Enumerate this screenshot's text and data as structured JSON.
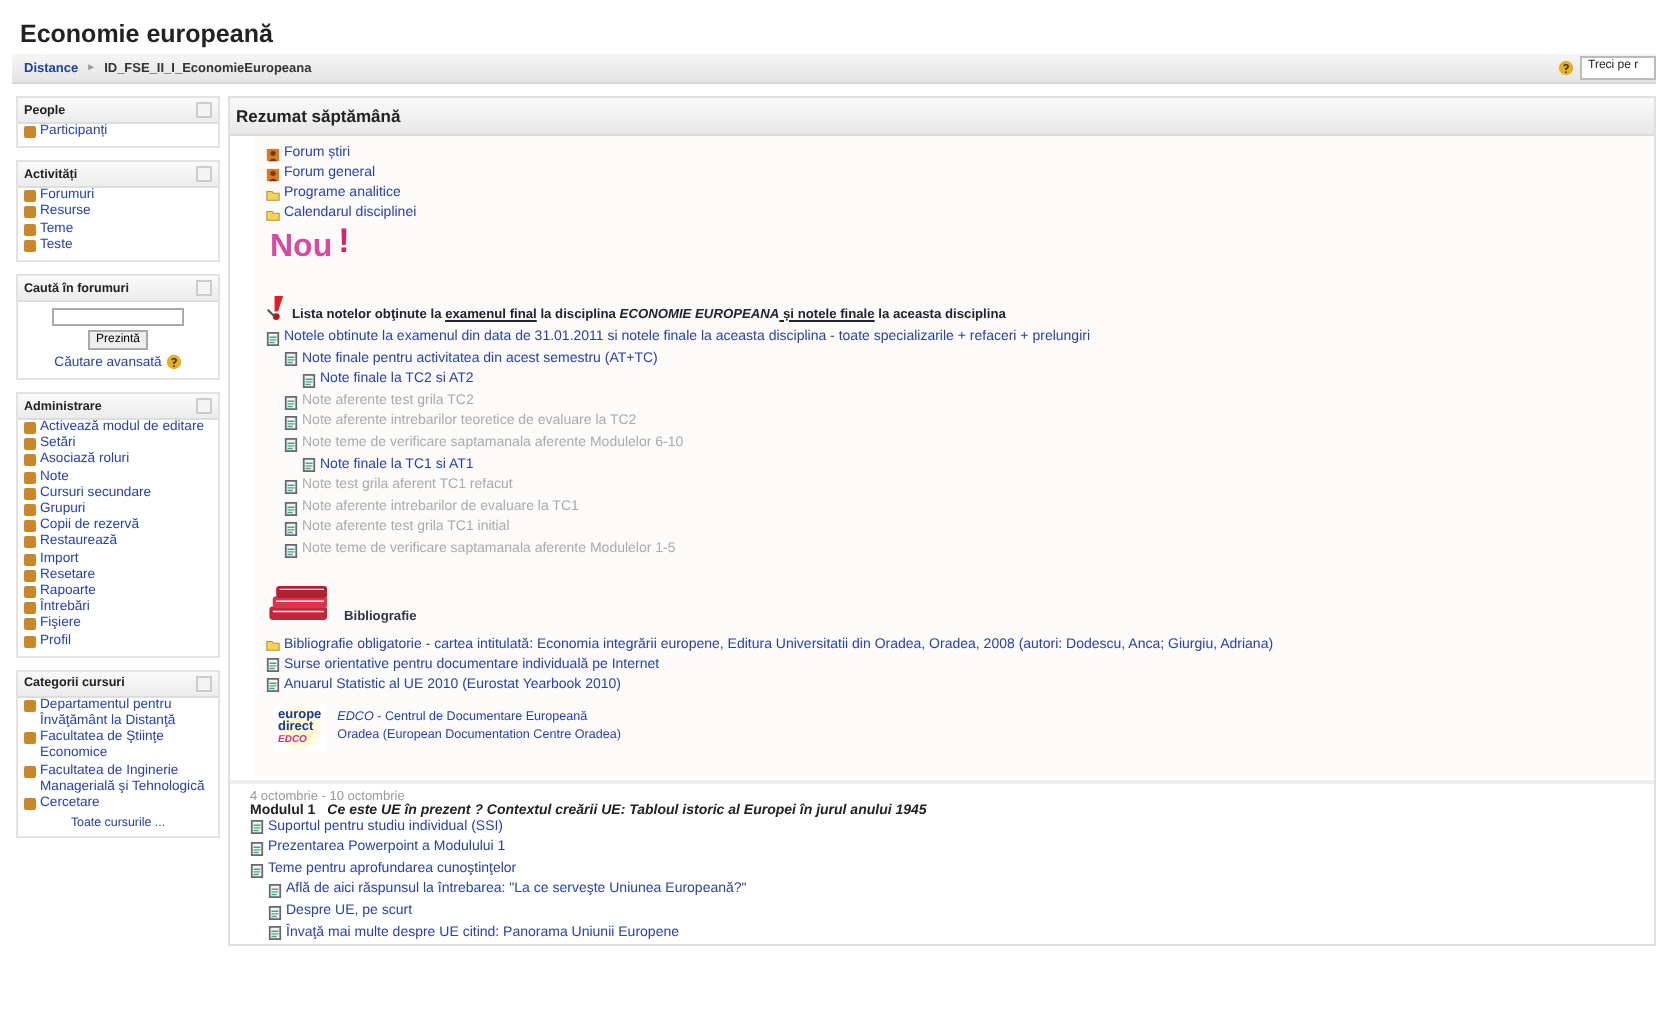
{
  "header": {
    "title": "Economie europeană",
    "breadcrumb": [
      {
        "label": "Distance",
        "link": true
      },
      {
        "label": "ID_FSE_II_I_EconomieEuropeana",
        "link": false
      }
    ],
    "separator": "►",
    "language_menu": {
      "value": "Treci pe r"
    }
  },
  "sidebar": {
    "blocks": [
      {
        "title": "People",
        "kind": "links",
        "items": [
          "Participanți"
        ]
      },
      {
        "title": "Activități",
        "kind": "links",
        "items": [
          "Forumuri",
          "Resurse",
          "Teme",
          "Teste"
        ]
      },
      {
        "title": "Caută în forumuri",
        "kind": "search",
        "button": "Prezintă",
        "advanced": "Căutare avansată"
      },
      {
        "title": "Administrare",
        "kind": "links",
        "items": [
          "Activează modul de editare",
          "Setări",
          "Asociază roluri",
          "Note",
          "Cursuri secundare",
          "Grupuri",
          "Copii de rezervă",
          "Restaurează",
          "Import",
          "Resetare",
          "Rapoarte",
          "Întrebări",
          "Fişiere",
          "Profil"
        ]
      },
      {
        "title": "Categorii cursuri",
        "kind": "links",
        "items": [
          "Departamentul pentru Învăţământ la Distanţă",
          "Facultatea de Ştiinţe Economice",
          "Facultatea de Inginerie Managerială şi Tehnologică",
          "Cercetare"
        ],
        "footer": "Toate cursurile ..."
      }
    ]
  },
  "main": {
    "title": "Rezumat săptămână",
    "resources": [
      {
        "kind": "forum",
        "label": "Forum știri"
      },
      {
        "kind": "forum",
        "label": "Forum general"
      },
      {
        "kind": "folder",
        "label": "Programe analitice"
      },
      {
        "kind": "folder",
        "label": "Calendarul disciplinei"
      }
    ],
    "new_banner": {
      "text": "Nou",
      "mark": "!"
    },
    "notice": [
      {
        "text": "Lista notelor obţinute la ",
        "link": false,
        "italic": false
      },
      {
        "text": "examenul final",
        "link": true,
        "italic": false
      },
      {
        "text": " la disciplina ",
        "link": false,
        "italic": false
      },
      {
        "text": "ECONOMIE EUROPEANA",
        "link": false,
        "italic": true
      },
      {
        "text": " și notele finale",
        "link": true,
        "italic": false
      },
      {
        "text": " la aceasta disciplina",
        "link": false,
        "italic": false
      }
    ],
    "tree": [
      {
        "label": "Notele obtinute la examenul din data de 31.01.2011 si notele finale la aceasta disciplina - toate specializarile + refaceri + prelungiri",
        "dimmed": false,
        "children": [
          {
            "label": "Note finale pentru activitatea din acest semestru (AT+TC)",
            "dimmed": false,
            "children": [
              {
                "label": "Note finale la TC2 si AT2",
                "dimmed": false
              }
            ]
          },
          {
            "label": "Note aferente test grila TC2",
            "dimmed": true
          },
          {
            "label": "Note aferente intrebarilor teoretice de evaluare la TC2",
            "dimmed": true
          },
          {
            "label": "Note teme de verificare saptamanala aferente Modulelor 6-10",
            "dimmed": true,
            "children": [
              {
                "label": "Note finale la TC1 si AT1",
                "dimmed": false
              }
            ]
          },
          {
            "label": "Note test grila aferent TC1 refacut",
            "dimmed": true
          },
          {
            "label": "Note aferente intrebarilor de evaluare la TC1",
            "dimmed": true
          },
          {
            "label": "Note aferente test grila TC1 initial",
            "dimmed": true
          },
          {
            "label": "Note teme de verificare saptamanala aferente Modulelor 1-5",
            "dimmed": true
          }
        ]
      }
    ],
    "bibliography": {
      "title": "Bibliografie",
      "items": [
        {
          "kind": "folder",
          "label": "Bibliografie obligatorie - cartea intitulată: Economia integrării europene, Editura Universitatii din Oradea, Oradea, 2008 (autori: Dodescu, Anca; Giurgiu, Adriana)"
        },
        {
          "kind": "file",
          "label": "Surse orientative pentru documentare individuală pe Internet"
        },
        {
          "kind": "file",
          "label": "Anuarul Statistic al UE 2010 (Eurostat Yearbook 2010)"
        }
      ],
      "logo": [
        "europe",
        "direct",
        "EDCO"
      ],
      "edco": [
        "*EDCO* - Centrul de Documentare Europeană",
        "Oradea (European Documentation Centre Oradea)"
      ]
    }
  },
  "week": {
    "dates": "4 octombrie - 10 octombrie",
    "module": "Modulul 1",
    "topic": "Ce este UE în prezent ? Contextul creării UE: Tabloul istoric al Europei în jurul anului 1945",
    "tree": [
      {
        "label": "Suportul pentru studiu individual (SSI)",
        "dimmed": false
      },
      {
        "label": "Prezentarea Powerpoint a Modulului 1",
        "dimmed": false
      },
      {
        "label": "Teme pentru aprofundarea cunoştinţelor",
        "dimmed": false,
        "children": [
          {
            "label": "Află de aici răspunsul la întrebarea: \"La ce serveşte Uniunea Europeană?\"",
            "dimmed": false
          },
          {
            "label": "Despre UE, pe scurt",
            "dimmed": false
          },
          {
            "label": "Învaţă mai multe despre UE citind: Panorama Uniunii Europene",
            "dimmed": false
          }
        ]
      }
    ]
  }
}
